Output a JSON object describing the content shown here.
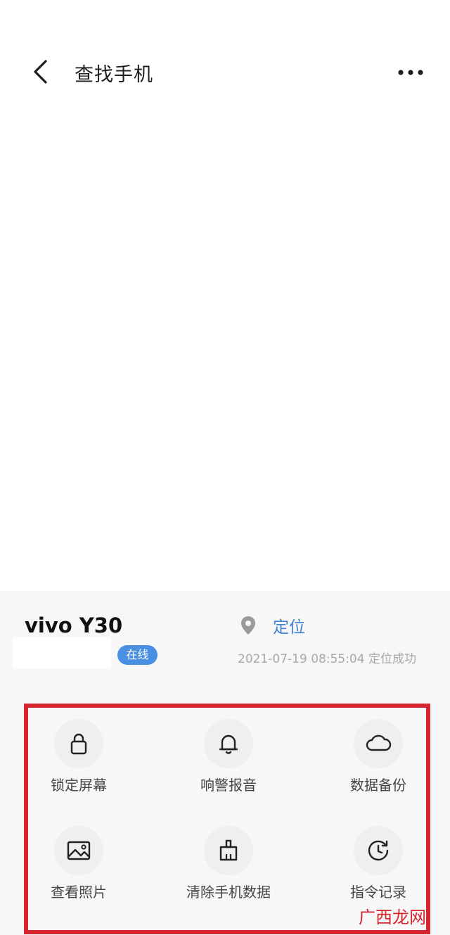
{
  "header": {
    "title": "查找手机"
  },
  "device": {
    "name": "vivo Y30",
    "status_badge": "在线",
    "locate_label": "定位",
    "locate_status": "2021-07-19 08:55:04 定位成功"
  },
  "actions": [
    {
      "label": "锁定屏幕",
      "icon": "lock-icon"
    },
    {
      "label": "响警报音",
      "icon": "bell-icon"
    },
    {
      "label": "数据备份",
      "icon": "cloud-icon"
    },
    {
      "label": "查看照片",
      "icon": "image-icon"
    },
    {
      "label": "清除手机数据",
      "icon": "brush-icon"
    },
    {
      "label": "指令记录",
      "icon": "history-icon"
    }
  ],
  "watermark": "广西龙网",
  "colors": {
    "accent_blue": "#3f7fd2",
    "badge_blue": "#4a90e2",
    "highlight_red": "#d8242e"
  }
}
